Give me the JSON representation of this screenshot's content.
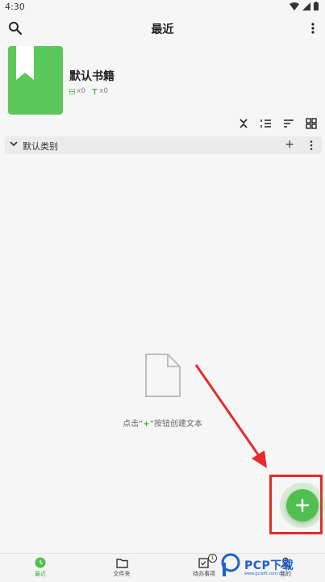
{
  "status_bar": {
    "time": "4:30"
  },
  "appbar": {
    "title": "最近"
  },
  "book": {
    "title": "默认书籍",
    "notes_count": "x0",
    "text_count": "x0"
  },
  "category": {
    "label": "默认类别",
    "add_label": "+"
  },
  "empty_state": {
    "text_before": "点击“",
    "plus": "+",
    "text_after": "”按钮创建文本"
  },
  "bottom_nav": {
    "items": [
      {
        "label": "最近",
        "icon": "clock-icon",
        "active": true
      },
      {
        "label": "文件夹",
        "icon": "folder-icon",
        "active": false
      },
      {
        "label": "待办事项",
        "icon": "todo-icon",
        "active": false,
        "badge": "1"
      },
      {
        "label": "我的",
        "icon": "profile-icon",
        "active": false
      }
    ]
  },
  "watermark": {
    "text": "PCP下载",
    "sub": "www.pcsoft.com.cn"
  },
  "colors": {
    "accent": "#4fbf4f",
    "book": "#5bc85b",
    "highlight": "#e52b2b",
    "watermark": "#1d62c9"
  }
}
